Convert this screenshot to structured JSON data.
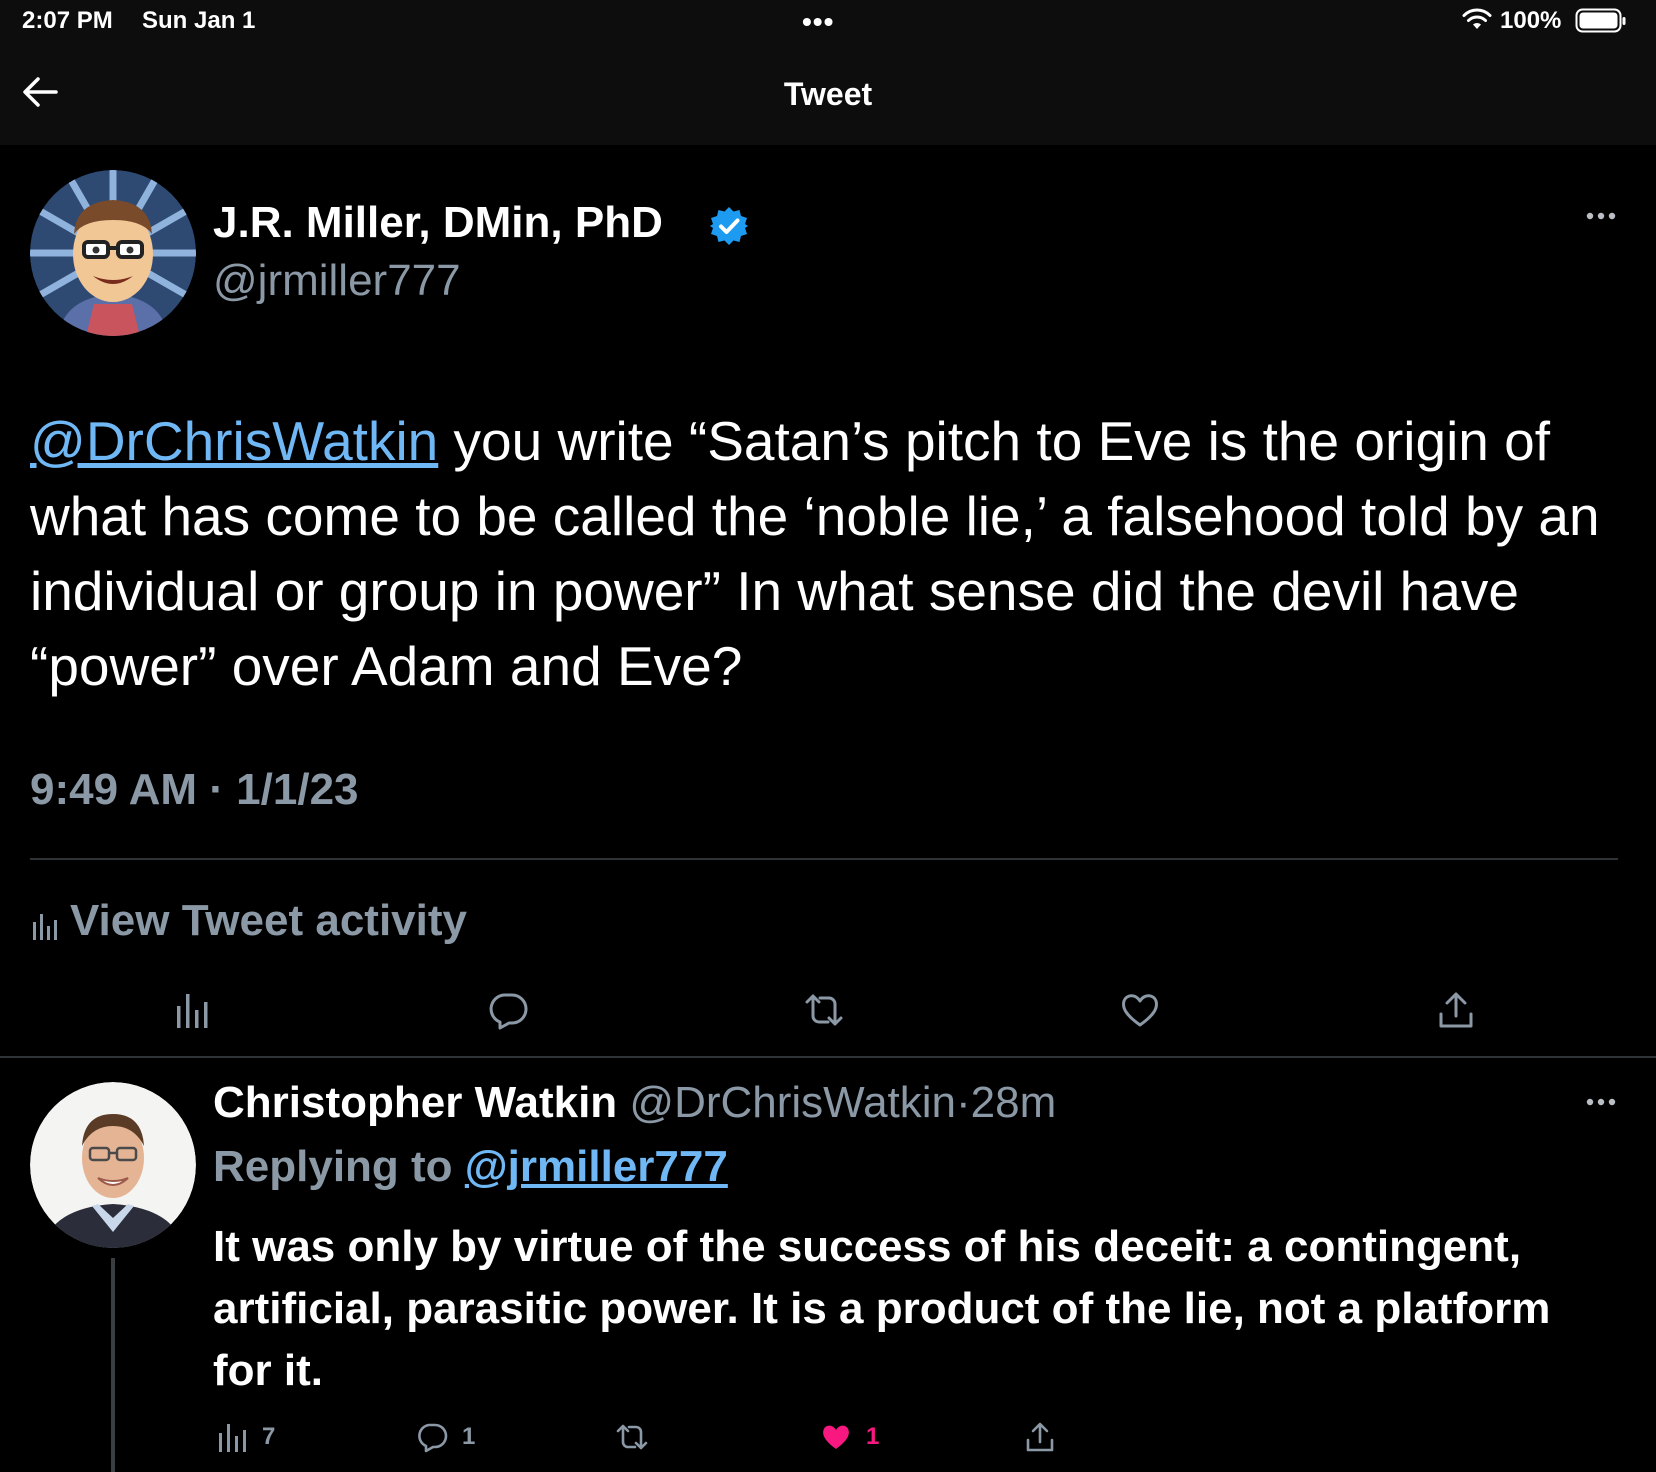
{
  "status_bar": {
    "time": "2:07 PM",
    "date": "Sun Jan 1",
    "battery": "100%"
  },
  "nav": {
    "title": "Tweet"
  },
  "tweet": {
    "author_name": "J.R. Miller, DMin, PhD",
    "author_handle": "@jrmiller777",
    "mention": "@DrChrisWatkin",
    "body": " you write “Satan’s pitch to Eve is the origin of what has come to be called the ‘noble lie,’ a falsehood told by an individual or group in power”  In what sense did the devil have “power” over Adam and Eve?",
    "timestamp": "9:49 AM · 1/1/23",
    "activity_label": "View Tweet activity"
  },
  "reply": {
    "author_name": "Christopher Watkin",
    "author_handle": "@DrChrisWatkin",
    "separator": "·",
    "time": "28m",
    "replying_prefix": "Replying to ",
    "replying_handle": "@jrmiller777",
    "body": "It was only by virtue of the success of his deceit: a contingent, artificial, parasitic power. It is a product of the lie, not a platform for it.",
    "views": "7",
    "replies": "1",
    "likes": "1"
  },
  "colors": {
    "background": "#000000",
    "text": "#ffffff",
    "secondary": "#8b98a5",
    "link": "#6fb8f5",
    "verified": "#1d9bf0",
    "like": "#f91880"
  },
  "icons": [
    "back-arrow-icon",
    "verified-badge-icon",
    "more-icon",
    "analytics-icon",
    "reply-icon",
    "retweet-icon",
    "like-icon",
    "share-icon",
    "wifi-icon",
    "battery-icon"
  ]
}
